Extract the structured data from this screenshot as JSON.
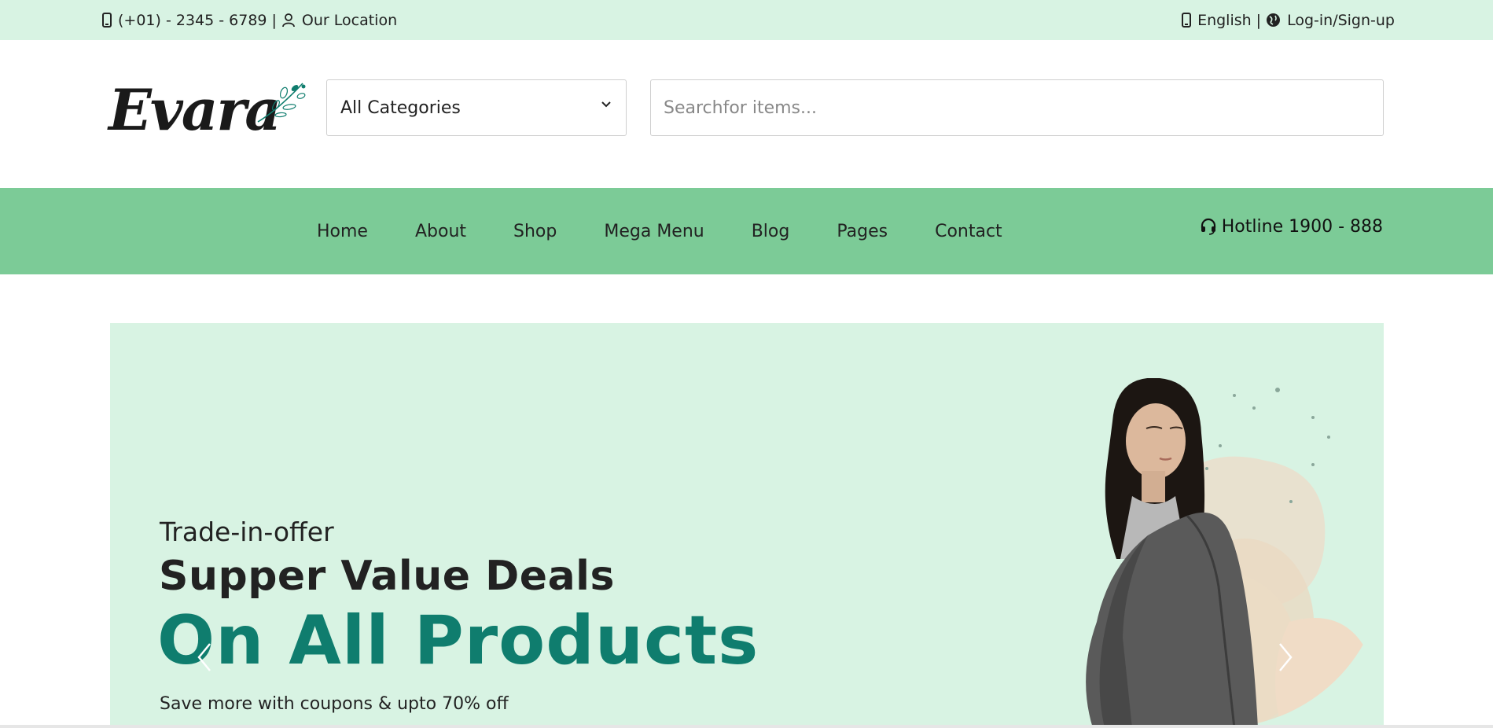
{
  "topbar": {
    "phone": "(+01) - 2345 - 6789",
    "separator": "|",
    "location": "Our Location",
    "language": "English",
    "auth": "Log-in/Sign-up"
  },
  "header": {
    "logo_text": "Evara",
    "category_select": "All Categories",
    "search_placeholder": "Searchfor items..."
  },
  "nav": {
    "items": [
      "Home",
      "About",
      "Shop",
      "Mega Menu",
      "Blog",
      "Pages",
      "Contact"
    ],
    "hotline": "Hotline 1900 - 888"
  },
  "hero": {
    "subtitle": "Trade-in-offer",
    "heading": "Supper Value Deals",
    "headline": "On All Products",
    "note": "Save more with coupons & upto 70% off"
  },
  "colors": {
    "topbar_bg": "#d8f3e3",
    "nav_bg": "#7ccb97",
    "hero_bg": "#d8f3e3",
    "accent": "#0f7d6e"
  },
  "icons": [
    "phone-icon",
    "user-icon",
    "globe-icon",
    "chevron-down-icon",
    "headset-icon",
    "chevron-left-icon",
    "chevron-right-icon"
  ]
}
